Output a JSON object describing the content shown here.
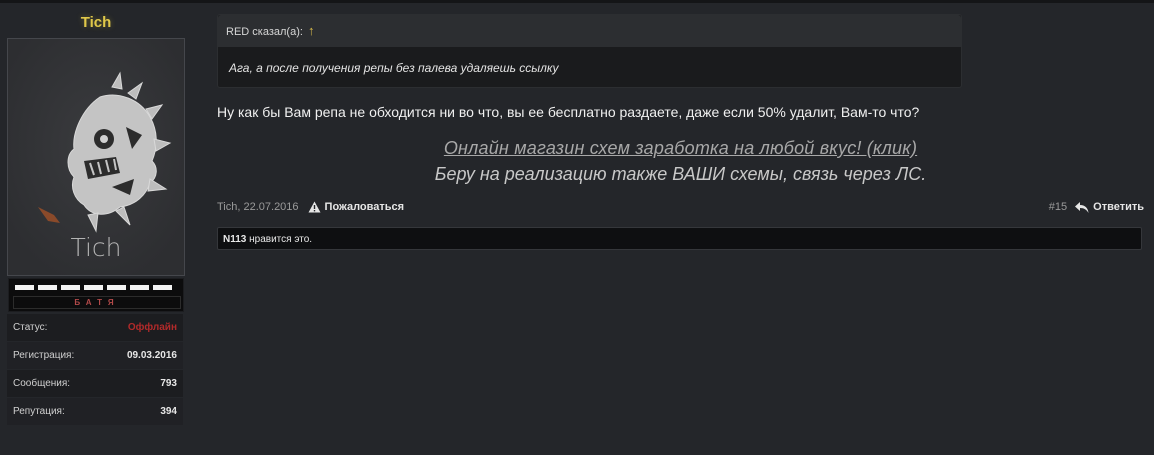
{
  "user": {
    "name": "Tich",
    "avatar_caption": "Tich",
    "rank_label": "БАТЯ",
    "info": [
      {
        "label": "Статус:",
        "value": "Оффлайн"
      },
      {
        "label": "Регистрация:",
        "value": "09.03.2016"
      },
      {
        "label": "Сообщения:",
        "value": "793"
      },
      {
        "label": "Репутация:",
        "value": "394"
      }
    ]
  },
  "quote": {
    "author": "RED сказал(а):",
    "arrow": "↑",
    "text": "Ага, а после получения репы без палева удаляешь ссылку"
  },
  "post": {
    "text": "Ну как бы Вам репа не обходится ни во что, вы ее бесплатно раздаете, даже если 50% удалит, Вам-то что?"
  },
  "signature": {
    "link": "Онлайн магазин схем заработка на любой вкус! (клик)",
    "line2": "Беру на реализацию также ВАШИ схемы, связь через ЛС."
  },
  "meta": {
    "author_date": "Tich, 22.07.2016",
    "report": "Пожаловаться",
    "post_number": "#15",
    "reply": "Ответить"
  },
  "likes": {
    "user": "N113",
    "text": " нравится это."
  },
  "colors": {
    "background": "#24262a",
    "username": "#e0c84a",
    "offline": "#b22a2a",
    "quote_arrow": "#d9bb4a"
  }
}
